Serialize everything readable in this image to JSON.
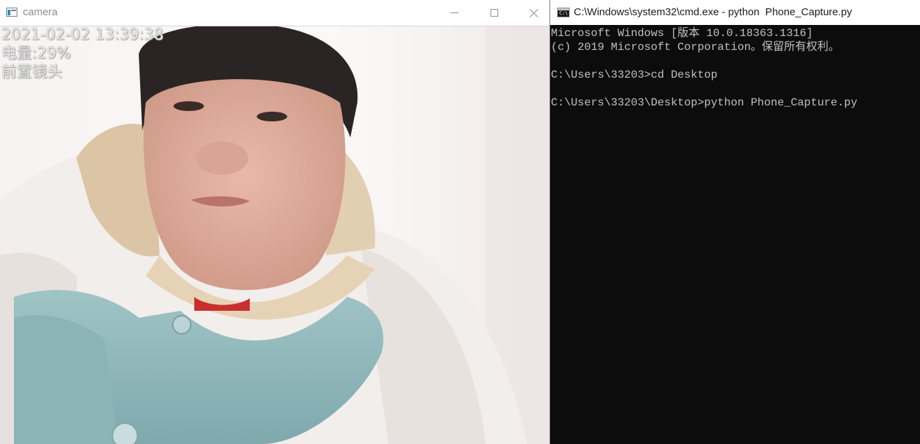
{
  "camera_window": {
    "title": "camera",
    "icon": "app-window-icon",
    "controls": {
      "minimize_icon": "minimize-icon",
      "maximize_icon": "maximize-icon",
      "close_icon": "close-icon"
    },
    "overlay": {
      "timestamp": "2021-02-02 13:39:38",
      "battery": "电量:29%",
      "camera_label": "前置镜头"
    }
  },
  "cmd_window": {
    "title": "C:\\Windows\\system32\\cmd.exe - python  Phone_Capture.py",
    "icon": "cmd-icon",
    "icon_text": "C:\\",
    "lines": [
      "Microsoft Windows [版本 10.0.18363.1316]",
      "(c) 2019 Microsoft Corporation。保留所有权利。",
      "",
      "C:\\Users\\33203>cd Desktop",
      "",
      "C:\\Users\\33203\\Desktop>python Phone_Capture.py"
    ]
  },
  "colors": {
    "console_background": "#0c0c0c",
    "console_text": "#c0c0c0",
    "overlay_text": "#e4e4e4"
  }
}
